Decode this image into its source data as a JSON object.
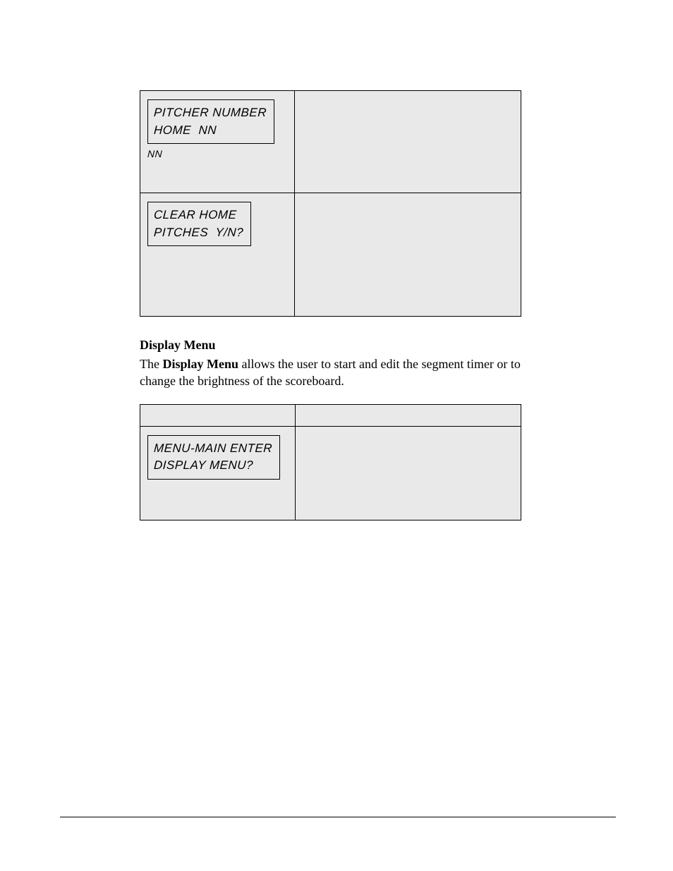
{
  "table1": {
    "row1": {
      "lcd_line1": "PITCHER NUMBER",
      "lcd_line2": "HOME  NN",
      "below_box": "NN"
    },
    "row2": {
      "lcd_line1": "CLEAR HOME",
      "lcd_line2": "PITCHES  Y/N?"
    }
  },
  "section": {
    "heading": "Display Menu",
    "para_prefix": "The ",
    "para_bold": "Display Menu",
    "para_rest": " allows the user to start and edit the segment timer or to change the brightness of the scoreboard."
  },
  "table2": {
    "row1": {
      "lcd_line1": "MENU-MAIN ENTER",
      "lcd_line2": "DISPLAY MENU?"
    }
  }
}
